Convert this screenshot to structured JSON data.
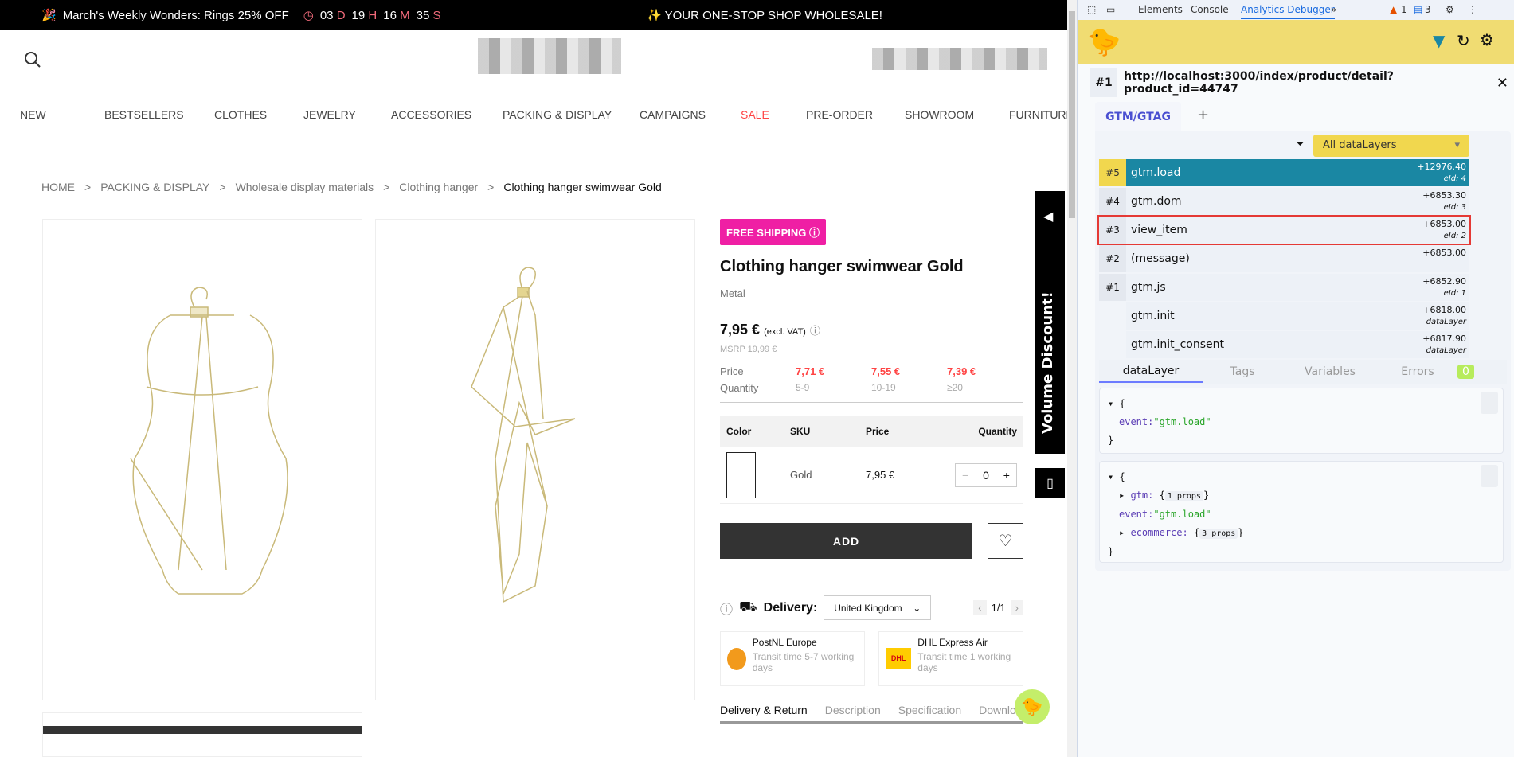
{
  "topbar": {
    "promo": "March's Weekly Wonders: Rings 25% OFF",
    "countdown": [
      {
        "v": "03",
        "u": "D"
      },
      {
        "v": "19",
        "u": "H"
      },
      {
        "v": "16",
        "u": "M"
      },
      {
        "v": "35",
        "u": "S"
      }
    ],
    "slogan": "✨ YOUR ONE-STOP SHOP WHOLESALE!"
  },
  "nav": [
    "NEW",
    "BESTSELLERS",
    "CLOTHES",
    "JEWELRY",
    "ACCESSORIES",
    "PACKING & DISPLAY",
    "CAMPAIGNS",
    "SALE",
    "PRE-ORDER",
    "SHOWROOM",
    "FURNITURE"
  ],
  "breadcrumb": [
    "HOME",
    "PACKING & DISPLAY",
    "Wholesale display materials",
    "Clothing hanger",
    "Clothing hanger swimwear Gold"
  ],
  "product": {
    "badge": "FREE SHIPPING",
    "title": "Clothing hanger swimwear Gold",
    "material": "Metal",
    "price": "7,95 €",
    "vat": "(excl. VAT)",
    "msrp": "MSRP 19,99 €",
    "tiers": {
      "price_label": "Price",
      "qty_label": "Quantity",
      "prices": [
        "7,71 €",
        "7,55 €",
        "7,39 €"
      ],
      "qtys": [
        "5-9",
        "10-19",
        "≥20"
      ]
    },
    "table": {
      "headers": [
        "Color",
        "SKU",
        "Price",
        "Quantity"
      ],
      "row": {
        "sku": "Gold",
        "price": "7,95 €",
        "qty": "0"
      }
    },
    "add": "ADD",
    "delivery_label": "Delivery:",
    "country": "United Kingdom",
    "pager": "1/1",
    "carriers": [
      {
        "name": "PostNL Europe",
        "transit": "Transit time 5-7 working days"
      },
      {
        "name": "DHL Express Air",
        "transit": "Transit time 1 working days"
      }
    ],
    "tabs": [
      "Delivery & Return",
      "Description",
      "Specification",
      "Downloa"
    ],
    "volume_tab": "Volume Discount!"
  },
  "devtools": {
    "tabs": [
      "Elements",
      "Console",
      "Analytics Debugger"
    ],
    "warnings": "1",
    "messages": "3",
    "url_index": "#1",
    "url": "http://localhost:3000/index/product/detail?product_id=44747",
    "gtm_tab": "GTM/GTAG",
    "filter": "All dataLayers",
    "events": [
      {
        "n": "#5",
        "name": "gtm.load",
        "t": "+12976.40",
        "sub": "eId: 4",
        "active": true
      },
      {
        "n": "#4",
        "name": "gtm.dom",
        "t": "+6853.30",
        "sub": "eId: 3"
      },
      {
        "n": "#3",
        "name": "view_item",
        "t": "+6853.00",
        "sub": "eId: 2",
        "highlight": true
      },
      {
        "n": "#2",
        "name": "(message)",
        "t": "+6853.00",
        "sub": ""
      },
      {
        "n": "#1",
        "name": "gtm.js",
        "t": "+6852.90",
        "sub": "eId: 1"
      },
      {
        "n": "",
        "name": "gtm.init",
        "t": "+6818.00",
        "sub": "dataLayer"
      },
      {
        "n": "",
        "name": "gtm.init_consent",
        "t": "+6817.90",
        "sub": "dataLayer"
      }
    ],
    "subtabs": [
      "dataLayer",
      "Tags",
      "Variables",
      "Errors"
    ],
    "errors": "0",
    "json1": {
      "key": "event:",
      "val": "\"gtm.load\""
    },
    "json2": {
      "gtm": "gtm:",
      "gtm_props": "1 props",
      "event": "event:",
      "event_val": "\"gtm.load\"",
      "ecom": "ecommerce:",
      "ecom_props": "3 props"
    }
  },
  "colors": {
    "accent_pink": "#ef1fa4",
    "sale_red": "#f44444",
    "debugger_yellow": "#f0dc72",
    "active_event": "#1a87a3"
  }
}
